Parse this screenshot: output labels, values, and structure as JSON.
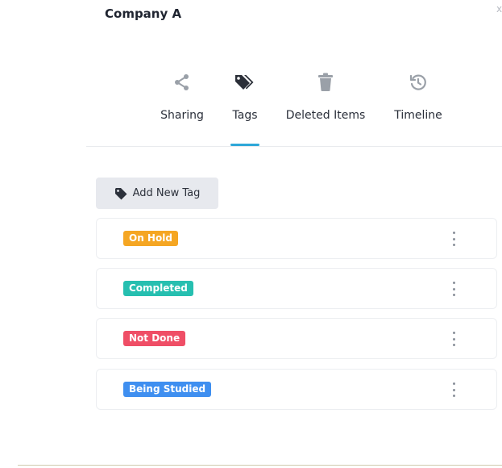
{
  "panel": {
    "title": "Company A",
    "close_glyph": "x"
  },
  "tabs": [
    {
      "label": "Sharing",
      "icon": "share-icon",
      "active": false
    },
    {
      "label": "Tags",
      "icon": "tags-icon",
      "active": true
    },
    {
      "label": "Deleted Items",
      "icon": "trash-icon",
      "active": false
    },
    {
      "label": "Timeline",
      "icon": "history-icon",
      "active": false
    }
  ],
  "add_tag": {
    "label": "Add New Tag",
    "icon": "tag-icon"
  },
  "tags": [
    {
      "label": "On Hold",
      "color": "#f5a623"
    },
    {
      "label": "Completed",
      "color": "#26bfb0"
    },
    {
      "label": "Not Done",
      "color": "#ef4e66"
    },
    {
      "label": "Being Studied",
      "color": "#3f8ff0"
    }
  ],
  "colors": {
    "active_tab_underline": "#2ea7d8",
    "inactive_icon": "#9aa0a8",
    "active_icon": "#2b2f38"
  }
}
